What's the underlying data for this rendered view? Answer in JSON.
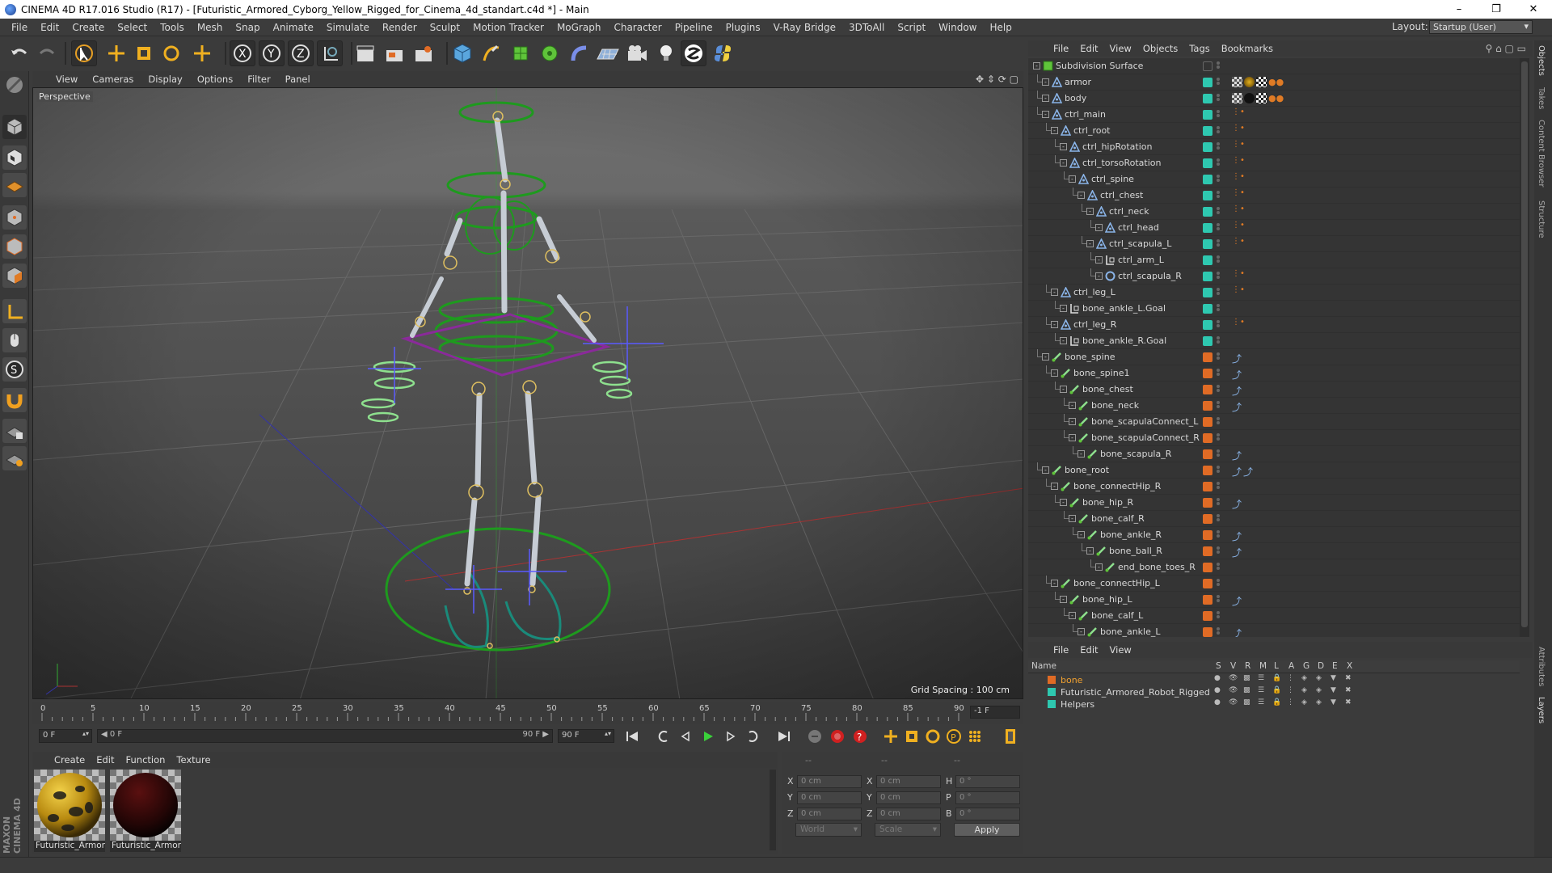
{
  "window": {
    "title": "CINEMA 4D R17.016 Studio (R17) - [Futuristic_Armored_Cyborg_Yellow_Rigged_for_Cinema_4d_standart.c4d *] - Main"
  },
  "menu": [
    "File",
    "Edit",
    "Create",
    "Select",
    "Tools",
    "Mesh",
    "Snap",
    "Animate",
    "Simulate",
    "Render",
    "Sculpt",
    "Motion Tracker",
    "MoGraph",
    "Character",
    "Pipeline",
    "Plugins",
    "V-Ray Bridge",
    "3DToAll",
    "Script",
    "Window",
    "Help"
  ],
  "layout": {
    "label": "Layout:",
    "value": "Startup (User)"
  },
  "viewport": {
    "menu": [
      "View",
      "Cameras",
      "Display",
      "Options",
      "Filter",
      "Panel"
    ],
    "label": "Perspective",
    "grid_spacing": "Grid Spacing : 100 cm"
  },
  "timeline": {
    "ticks": [
      "0",
      "5",
      "10",
      "15",
      "20",
      "25",
      "30",
      "35",
      "40",
      "45",
      "50",
      "55",
      "60",
      "65",
      "70",
      "75",
      "80",
      "85",
      "90"
    ],
    "current_frame": "-1 F",
    "start": "0 F",
    "range_start": "0 F",
    "range_end": "90 F",
    "end": "90 F"
  },
  "material": {
    "menu": [
      "Create",
      "Edit",
      "Function",
      "Texture"
    ],
    "items": [
      {
        "name": "Futuristic_Armor"
      },
      {
        "name": "Futuristic_Armor"
      }
    ]
  },
  "coords": {
    "header": [
      "--",
      "--",
      "--"
    ],
    "rows": [
      {
        "a": "X",
        "av": "0 cm",
        "b": "X",
        "bv": "0 cm",
        "c": "H",
        "cv": "0 °"
      },
      {
        "a": "Y",
        "av": "0 cm",
        "b": "Y",
        "bv": "0 cm",
        "c": "P",
        "cv": "0 °"
      },
      {
        "a": "Z",
        "av": "0 cm",
        "b": "Z",
        "bv": "0 cm",
        "c": "B",
        "cv": "0 °"
      }
    ],
    "world": "World",
    "scale": "Scale",
    "apply": "Apply"
  },
  "objects": {
    "menu": [
      "File",
      "Edit",
      "View",
      "Objects",
      "Tags",
      "Bookmarks"
    ],
    "items": [
      {
        "name": "Subdivision Surface",
        "depth": 0,
        "type": "subd",
        "layer": "",
        "tags": "subd"
      },
      {
        "name": "armor",
        "depth": 1,
        "type": "null",
        "layer": "#2ec8b0",
        "tags": "mat"
      },
      {
        "name": "body",
        "depth": 1,
        "type": "null",
        "layer": "#2ec8b0",
        "tags": "mat2"
      },
      {
        "name": "ctrl_main",
        "depth": 1,
        "type": "null",
        "layer": "#2ec8b0",
        "tags": "dot"
      },
      {
        "name": "ctrl_root",
        "depth": 2,
        "type": "null",
        "layer": "#2ec8b0",
        "tags": "dot"
      },
      {
        "name": "ctrl_hipRotation",
        "depth": 3,
        "type": "null",
        "layer": "#2ec8b0",
        "tags": "dot"
      },
      {
        "name": "ctrl_torsoRotation",
        "depth": 3,
        "type": "null",
        "layer": "#2ec8b0",
        "tags": "dot"
      },
      {
        "name": "ctrl_spine",
        "depth": 4,
        "type": "null",
        "layer": "#2ec8b0",
        "tags": "dot"
      },
      {
        "name": "ctrl_chest",
        "depth": 5,
        "type": "null",
        "layer": "#2ec8b0",
        "tags": "dot"
      },
      {
        "name": "ctrl_neck",
        "depth": 6,
        "type": "null",
        "layer": "#2ec8b0",
        "tags": "dot"
      },
      {
        "name": "ctrl_head",
        "depth": 7,
        "type": "null",
        "layer": "#2ec8b0",
        "tags": "dot"
      },
      {
        "name": "ctrl_scapula_L",
        "depth": 6,
        "type": "null",
        "layer": "#2ec8b0",
        "tags": "dot"
      },
      {
        "name": "ctrl_arm_L",
        "depth": 7,
        "type": "goal",
        "layer": "#2ec8b0",
        "tags": ""
      },
      {
        "name": "ctrl_scapula_R",
        "depth": 7,
        "type": "circle",
        "layer": "#2ec8b0",
        "tags": "dot"
      },
      {
        "name": "ctrl_leg_L",
        "depth": 2,
        "type": "null",
        "layer": "#2ec8b0",
        "tags": "dot"
      },
      {
        "name": "bone_ankle_L.Goal",
        "depth": 3,
        "type": "goal",
        "layer": "#2ec8b0",
        "tags": ""
      },
      {
        "name": "ctrl_leg_R",
        "depth": 2,
        "type": "null",
        "layer": "#2ec8b0",
        "tags": "dot"
      },
      {
        "name": "bone_ankle_R.Goal",
        "depth": 3,
        "type": "goal",
        "layer": "#2ec8b0",
        "tags": ""
      },
      {
        "name": "bone_spine",
        "depth": 1,
        "type": "bone",
        "layer": "#e06b25",
        "tags": "ik"
      },
      {
        "name": "bone_spine1",
        "depth": 2,
        "type": "bone",
        "layer": "#e06b25",
        "tags": "ik"
      },
      {
        "name": "bone_chest",
        "depth": 3,
        "type": "bone",
        "layer": "#e06b25",
        "tags": "ik"
      },
      {
        "name": "bone_neck",
        "depth": 4,
        "type": "bone",
        "layer": "#e06b25",
        "tags": "ik"
      },
      {
        "name": "bone_scapulaConnect_L",
        "depth": 4,
        "type": "bone",
        "layer": "#e06b25",
        "tags": ""
      },
      {
        "name": "bone_scapulaConnect_R",
        "depth": 4,
        "type": "bone",
        "layer": "#e06b25",
        "tags": ""
      },
      {
        "name": "bone_scapula_R",
        "depth": 5,
        "type": "bone",
        "layer": "#e06b25",
        "tags": "ik"
      },
      {
        "name": "bone_root",
        "depth": 1,
        "type": "bone",
        "layer": "#e06b25",
        "tags": "ik2"
      },
      {
        "name": "bone_connectHip_R",
        "depth": 2,
        "type": "bone",
        "layer": "#e06b25",
        "tags": ""
      },
      {
        "name": "bone_hip_R",
        "depth": 3,
        "type": "bone",
        "layer": "#e06b25",
        "tags": "ik"
      },
      {
        "name": "bone_calf_R",
        "depth": 4,
        "type": "bone",
        "layer": "#e06b25",
        "tags": ""
      },
      {
        "name": "bone_ankle_R",
        "depth": 5,
        "type": "bone",
        "layer": "#e06b25",
        "tags": "ik"
      },
      {
        "name": "bone_ball_R",
        "depth": 6,
        "type": "bone",
        "layer": "#e06b25",
        "tags": "ik"
      },
      {
        "name": "end_bone_toes_R",
        "depth": 7,
        "type": "bone",
        "layer": "#e06b25",
        "tags": ""
      },
      {
        "name": "bone_connectHip_L",
        "depth": 2,
        "type": "bone",
        "layer": "#e06b25",
        "tags": ""
      },
      {
        "name": "bone_hip_L",
        "depth": 3,
        "type": "bone",
        "layer": "#e06b25",
        "tags": "ik"
      },
      {
        "name": "bone_calf_L",
        "depth": 4,
        "type": "bone",
        "layer": "#e06b25",
        "tags": ""
      },
      {
        "name": "bone_ankle_L",
        "depth": 5,
        "type": "bone",
        "layer": "#e06b25",
        "tags": "ik"
      }
    ]
  },
  "layers": {
    "menu": [
      "File",
      "Edit",
      "View"
    ],
    "columns": [
      "Name",
      "S",
      "V",
      "R",
      "M",
      "L",
      "A",
      "G",
      "D",
      "E",
      "X"
    ],
    "items": [
      {
        "name": "bone",
        "color": "#e06b25"
      },
      {
        "name": "Futuristic_Armored_Robot_Rigged",
        "color": "#2ec8b0"
      },
      {
        "name": "Helpers",
        "color": "#2ec8b0"
      }
    ]
  },
  "side_tabs": [
    "Objects",
    "Takes",
    "Content Browser",
    "Structure",
    "Attributes",
    "Layers"
  ],
  "brand": "MAXON CINEMA 4D"
}
